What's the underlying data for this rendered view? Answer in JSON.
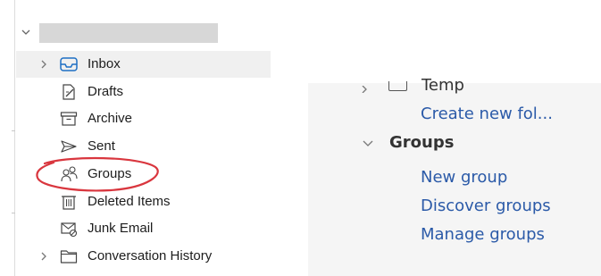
{
  "mac_folder_pane": {
    "account_name": "",
    "folders": [
      {
        "label": "Inbox",
        "icon": "inbox-tray-icon",
        "has_chevron": true,
        "selected": true
      },
      {
        "label": "Drafts",
        "icon": "drafts-pencil-icon",
        "has_chevron": false,
        "selected": false
      },
      {
        "label": "Archive",
        "icon": "archive-box-icon",
        "has_chevron": false,
        "selected": false
      },
      {
        "label": "Sent",
        "icon": "sent-paper-plane-icon",
        "has_chevron": false,
        "selected": false
      },
      {
        "label": "Groups",
        "icon": "groups-people-icon",
        "has_chevron": false,
        "selected": false
      },
      {
        "label": "Deleted Items",
        "icon": "trash-can-icon",
        "has_chevron": false,
        "selected": false
      },
      {
        "label": "Junk Email",
        "icon": "junk-envelope-icon",
        "has_chevron": false,
        "selected": false
      },
      {
        "label": "Conversation History",
        "icon": "folder-icon",
        "has_chevron": true,
        "selected": false
      }
    ],
    "annotation_color": "#d9363e"
  },
  "web_folder_pane": {
    "temp_label": "Temp",
    "create_new_folder": "Create new fol...",
    "groups_header": "Groups",
    "links": [
      "New group",
      "Discover groups",
      "Manage groups"
    ],
    "link_color": "#2b5aa8"
  }
}
